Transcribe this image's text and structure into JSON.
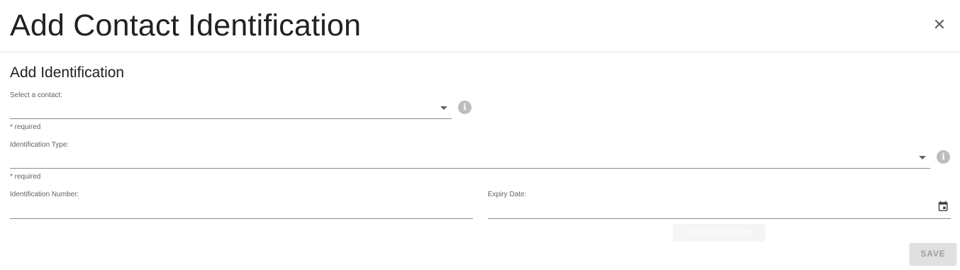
{
  "dialog": {
    "title": "Add Contact Identification",
    "close_glyph": "✕",
    "section_title": "Add Identification"
  },
  "form": {
    "contact": {
      "label": "Select a contact:",
      "value": "",
      "required_text": "* required",
      "icon": "info-icon"
    },
    "id_type": {
      "label": "Identification Type:",
      "value": "",
      "required_text": "* required",
      "icon": "info-icon"
    },
    "id_number": {
      "label": "Identification Number:",
      "value": ""
    },
    "expiry": {
      "label": "Expiry Date:",
      "value": "",
      "tooltip": "Enter the expiry date",
      "icon": "calendar-icon"
    }
  },
  "actions": {
    "save_label": "SAVE"
  },
  "colors": {
    "disabled_bg": "#e0e0e0",
    "disabled_text": "#9e9e9e",
    "info_icon": "#bdbdbd"
  }
}
